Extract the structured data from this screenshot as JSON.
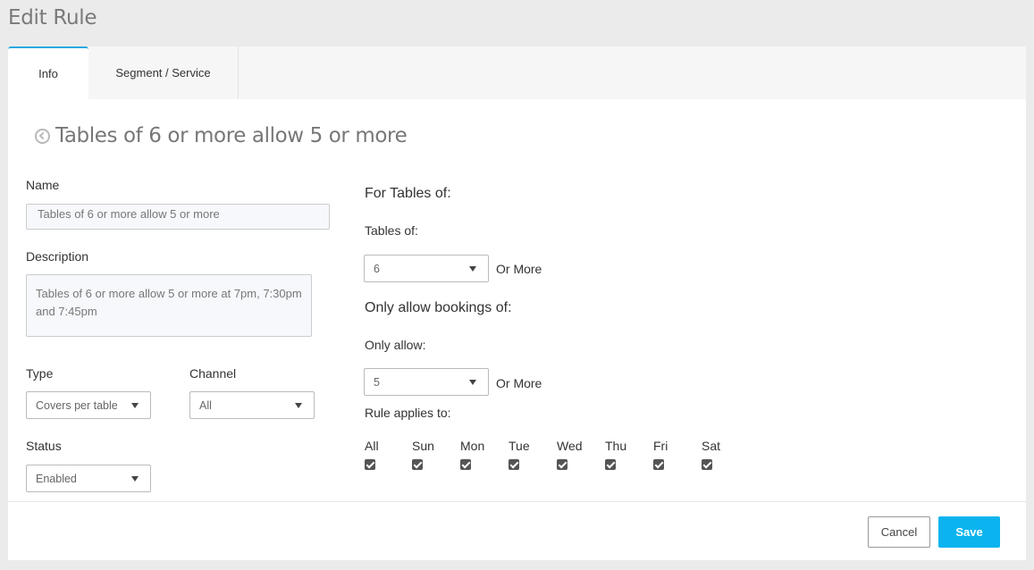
{
  "page": {
    "title": "Edit Rule"
  },
  "tabs": [
    {
      "label": "Info",
      "active": true
    },
    {
      "label": "Segment / Service",
      "active": false
    }
  ],
  "rule": {
    "title": "Tables of 6 or more allow 5 or more",
    "back_icon": "circle-chevron-left-icon"
  },
  "form": {
    "name_label": "Name",
    "name_value": "Tables of  6 or more allow 5 or more",
    "description_label": "Description",
    "description_value": "Tables of 6 or more allow 5 or more at 7pm, 7:30pm and 7:45pm",
    "type_label": "Type",
    "type_value": "Covers per table",
    "channel_label": "Channel",
    "channel_value": "All",
    "status_label": "Status",
    "status_value": "Enabled"
  },
  "tables": {
    "heading": "For Tables of:",
    "label": "Tables of:",
    "value": "6",
    "suffix": "Or More"
  },
  "allow": {
    "heading": "Only allow bookings of:",
    "label": "Only allow:",
    "value": "5",
    "suffix": "Or More"
  },
  "applies": {
    "label": "Rule applies to:",
    "days": [
      {
        "label": "All",
        "checked": true
      },
      {
        "label": "Sun",
        "checked": true
      },
      {
        "label": "Mon",
        "checked": true
      },
      {
        "label": "Tue",
        "checked": true
      },
      {
        "label": "Wed",
        "checked": true
      },
      {
        "label": "Thu",
        "checked": true
      },
      {
        "label": "Fri",
        "checked": true
      },
      {
        "label": "Sat",
        "checked": true
      }
    ]
  },
  "actions": {
    "cancel_label": "Cancel",
    "save_label": "Save"
  },
  "colors": {
    "accent": "#0bb4ee",
    "tab_indicator": "#29a8e0",
    "background": "#ebebeb"
  }
}
